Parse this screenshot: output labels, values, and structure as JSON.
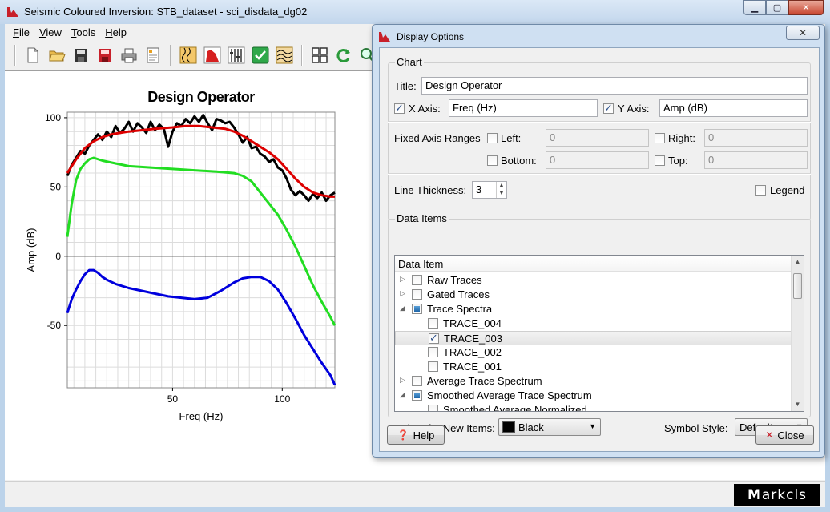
{
  "window": {
    "title": "Seismic Coloured Inversion: STB_dataset - sci_disdata_dg02",
    "minimize": "▁",
    "maximize": "▢",
    "close": "✕"
  },
  "menu": [
    {
      "label": "File",
      "key": "F",
      "rest": "ile"
    },
    {
      "label": "View",
      "key": "V",
      "rest": "iew"
    },
    {
      "label": "Tools",
      "key": "T",
      "rest": "ools"
    },
    {
      "label": "Help",
      "key": "H",
      "rest": "elp"
    }
  ],
  "toolbar_icons": [
    "new-file-icon",
    "open-folder-icon",
    "save-icon",
    "save-as-icon",
    "print-icon",
    "report-icon",
    "traces-icon",
    "spectrum-icon",
    "operator-sliders-icon",
    "apply-check-icon",
    "wavelet-icon",
    "grid-view-icon",
    "refresh-icon",
    "zoom-icon"
  ],
  "status": {
    "logo": "arkcls",
    "logo_mark": "M"
  },
  "chart_data": {
    "type": "line",
    "title": "Design Operator",
    "xlabel": "Freq (Hz)",
    "ylabel": "Amp (dB)",
    "xlim": [
      2,
      124
    ],
    "ylim": [
      -95,
      104
    ],
    "xticks": [
      50,
      100
    ],
    "yticks": [
      100,
      50,
      0,
      -50
    ],
    "grid": true,
    "zero_line": true,
    "series": [
      {
        "color": "#000000",
        "x": [
          2,
          4,
          6,
          8,
          10,
          12,
          14,
          16,
          18,
          20,
          22,
          24,
          26,
          28,
          30,
          32,
          34,
          36,
          38,
          40,
          42,
          44,
          46,
          48,
          50,
          52,
          54,
          56,
          58,
          60,
          62,
          64,
          66,
          68,
          70,
          72,
          74,
          76,
          78,
          80,
          82,
          84,
          86,
          88,
          90,
          92,
          94,
          96,
          98,
          100,
          102,
          104,
          106,
          108,
          110,
          112,
          114,
          116,
          118,
          120,
          122,
          124
        ],
        "y": [
          58,
          66,
          71,
          76,
          74,
          80,
          84,
          88,
          84,
          90,
          86,
          94,
          89,
          92,
          97,
          90,
          96,
          93,
          89,
          97,
          91,
          95,
          92,
          79,
          90,
          96,
          94,
          99,
          96,
          101,
          97,
          102,
          96,
          91,
          99,
          98,
          96,
          97,
          93,
          88,
          82,
          86,
          78,
          79,
          74,
          72,
          68,
          70,
          64,
          62,
          56,
          48,
          44,
          47,
          44,
          40,
          45,
          42,
          46,
          40,
          44,
          46
        ]
      },
      {
        "color": "#dd0000",
        "x": [
          2,
          6,
          10,
          14,
          18,
          22,
          26,
          30,
          36,
          42,
          50,
          56,
          62,
          68,
          74,
          78,
          82,
          86,
          90,
          94,
          98,
          102,
          106,
          110,
          114,
          118,
          122,
          124
        ],
        "y": [
          60,
          70,
          78,
          83,
          86,
          88,
          89,
          90,
          91,
          92,
          93,
          94,
          94,
          93,
          92,
          90,
          87,
          83,
          79,
          75,
          70,
          63,
          56,
          50,
          46,
          44,
          43,
          43
        ]
      },
      {
        "color": "#22dd22",
        "x": [
          2,
          4,
          6,
          8,
          10,
          12,
          14,
          18,
          24,
          30,
          40,
          50,
          60,
          70,
          78,
          82,
          86,
          90,
          94,
          98,
          102,
          106,
          110,
          114,
          118,
          122,
          124
        ],
        "y": [
          14,
          38,
          55,
          63,
          67,
          70,
          71,
          69,
          67,
          65,
          64,
          63,
          62,
          61,
          60,
          58,
          54,
          46,
          38,
          30,
          19,
          7,
          -7,
          -21,
          -33,
          -44,
          -50
        ]
      },
      {
        "color": "#0000dd",
        "x": [
          2,
          4,
          6,
          8,
          10,
          12,
          14,
          16,
          18,
          20,
          24,
          30,
          36,
          42,
          48,
          54,
          60,
          66,
          72,
          78,
          82,
          86,
          90,
          94,
          98,
          102,
          106,
          110,
          114,
          118,
          122,
          124
        ],
        "y": [
          -41,
          -31,
          -24,
          -18,
          -13,
          -10,
          -10,
          -12,
          -15,
          -17,
          -20,
          -23,
          -25,
          -27,
          -29,
          -30,
          -31,
          -30,
          -25,
          -19,
          -16,
          -15,
          -15,
          -18,
          -24,
          -34,
          -45,
          -57,
          -67,
          -77,
          -86,
          -93
        ]
      }
    ]
  },
  "dialog": {
    "title": "Display Options",
    "close": "✕",
    "chart_group": "Chart",
    "title_label": "Title:",
    "title_value": "Design Operator",
    "xaxis_label": "X Axis:",
    "xaxis_checked": true,
    "xaxis_value": "Freq (Hz)",
    "yaxis_label": "Y Axis:",
    "yaxis_checked": true,
    "yaxis_value": "Amp (dB)",
    "fixed_ranges_label": "Fixed Axis Ranges",
    "left_label": "Left:",
    "left_value": "0",
    "right_label": "Right:",
    "right_value": "0",
    "bottom_label": "Bottom:",
    "bottom_value": "0",
    "top_label": "Top:",
    "top_value": "0",
    "line_thickness_label": "Line Thickness:",
    "line_thickness_value": "3",
    "legend_label": "Legend",
    "legend_checked": false,
    "data_items_group": "Data Items",
    "tree_header": "Data Item",
    "tree": [
      {
        "label": "Raw Traces",
        "level": 0,
        "expander": "▷",
        "state": "unchecked"
      },
      {
        "label": "Gated Traces",
        "level": 0,
        "expander": "▷",
        "state": "unchecked"
      },
      {
        "label": "Trace Spectra",
        "level": 0,
        "expander": "◢",
        "state": "partial"
      },
      {
        "label": "TRACE_004",
        "level": 1,
        "expander": "",
        "state": "unchecked"
      },
      {
        "label": "TRACE_003",
        "level": 1,
        "expander": "",
        "state": "checked",
        "selected": true
      },
      {
        "label": "TRACE_002",
        "level": 1,
        "expander": "",
        "state": "unchecked"
      },
      {
        "label": "TRACE_001",
        "level": 1,
        "expander": "",
        "state": "unchecked"
      },
      {
        "label": "Average Trace Spectrum",
        "level": 0,
        "expander": "▷",
        "state": "unchecked"
      },
      {
        "label": "Smoothed Average Trace Spectrum",
        "level": 0,
        "expander": "◢",
        "state": "partial"
      },
      {
        "label": "Smoothed Average Normalized",
        "level": 1,
        "expander": "",
        "state": "unchecked"
      }
    ],
    "colour_label": "Colour for New Items:",
    "colour_value": "Black",
    "colour_swatch": "#000000",
    "symbol_label": "Symbol Style:",
    "symbol_value": "Default",
    "help_button": "Help",
    "close_button": "Close"
  }
}
